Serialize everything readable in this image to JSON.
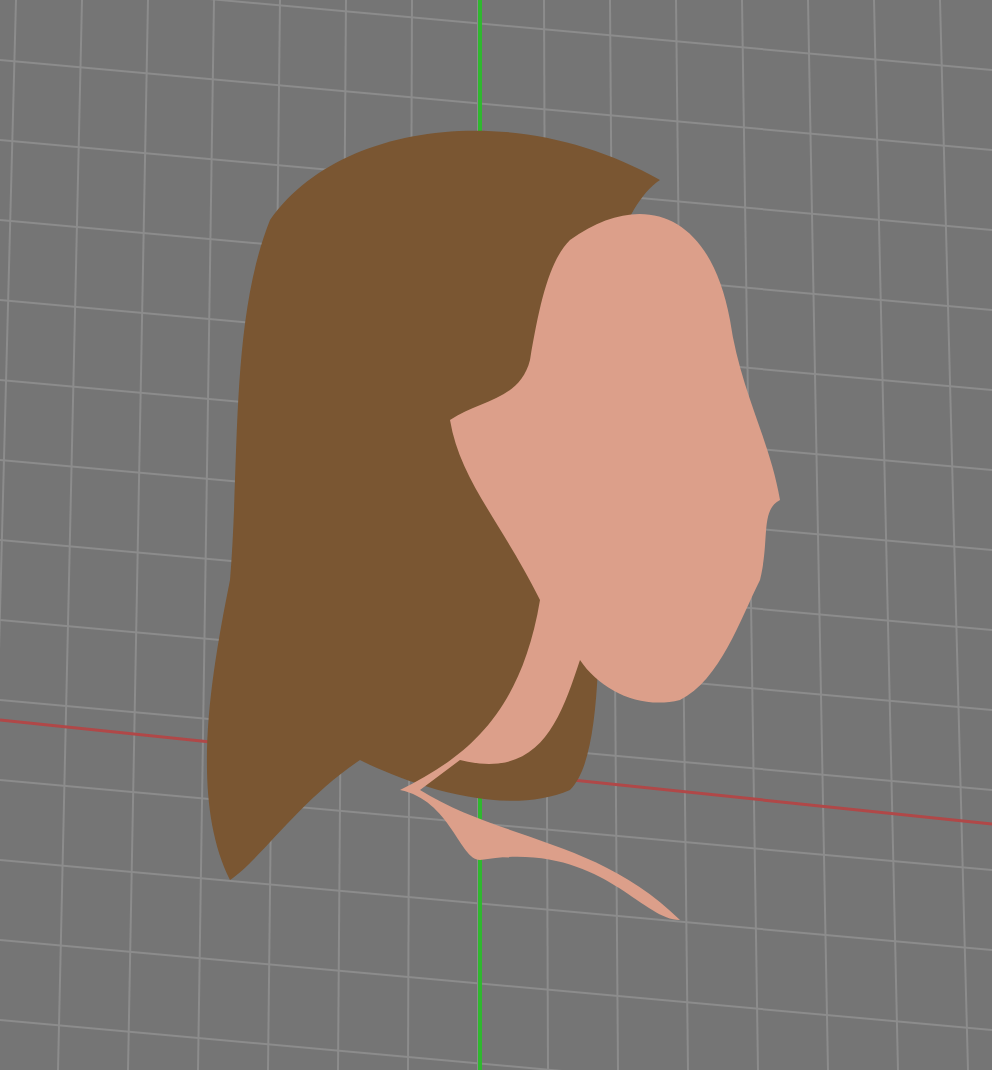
{
  "axes": [
    {
      "kind": "x",
      "color": "#b04848"
    },
    {
      "kind": "y",
      "color": "#2fb82f"
    }
  ]
}
